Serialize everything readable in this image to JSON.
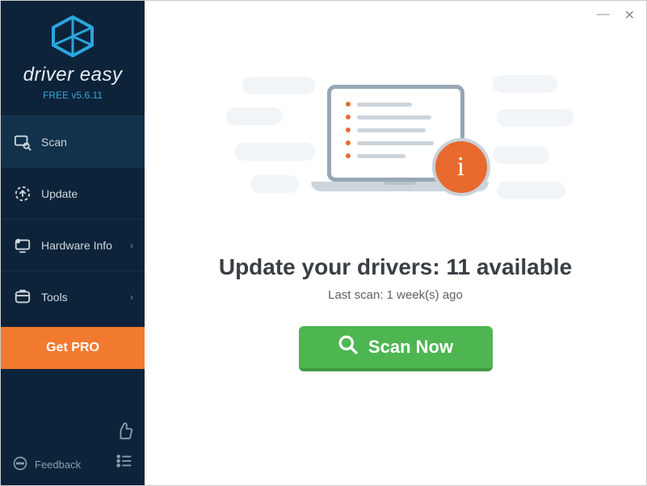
{
  "brand": {
    "title": "driver easy",
    "subtitle": "FREE v5.6.11"
  },
  "sidebar": {
    "items": [
      {
        "label": "Scan"
      },
      {
        "label": "Update"
      },
      {
        "label": "Hardware Info"
      },
      {
        "label": "Tools"
      }
    ],
    "getpro_label": "Get PRO",
    "feedback_label": "Feedback"
  },
  "main": {
    "headline": "Update your drivers: 11 available",
    "subline": "Last scan: 1 week(s) ago",
    "scan_button": "Scan Now",
    "info_badge": "i"
  },
  "colors": {
    "accent_orange": "#e86a2f",
    "accent_green": "#4eb651",
    "sidebar_bg": "#0d2339"
  }
}
